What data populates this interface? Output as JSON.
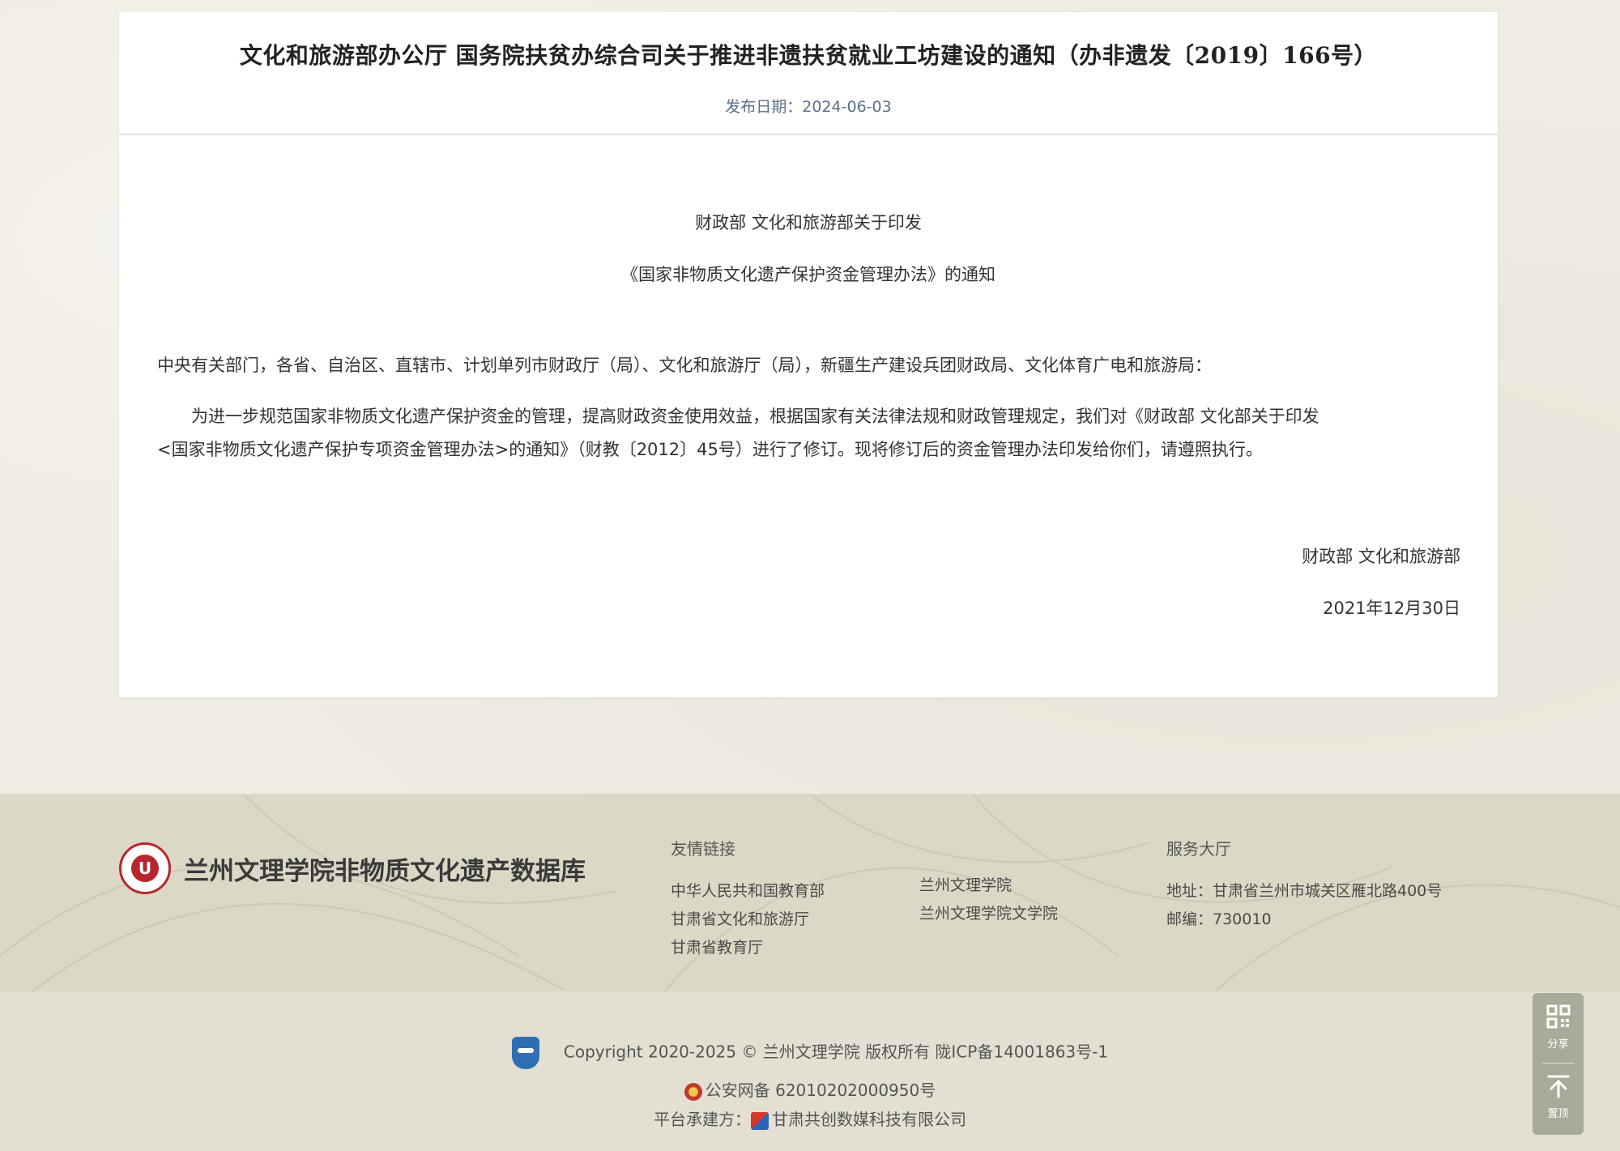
{
  "article": {
    "title": "文化和旅游部办公厅 国务院扶贫办综合司关于推进非遗扶贫就业工坊建设的通知（办非遗发〔2019〕166号）",
    "publish_label": "发布日期：",
    "publish_date": "2024-06-03",
    "doc_heading_1": "财政部 文化和旅游部关于印发",
    "doc_heading_2": "《国家非物质文化遗产保护资金管理办法》的通知",
    "addressee": "中央有关部门，各省、自治区、直辖市、计划单列市财政厅（局）、文化和旅游厅（局），新疆生产建设兵团财政局、文化体育广电和旅游局：",
    "body_line_1": "为进一步规范国家非物质文化遗产保护资金的管理，提高财政资金使用效益，根据国家有关法律法规和财政管理规定，我们对《财政部 文化部关于印发",
    "body_line_2": "<国家非物质文化遗产保护专项资金管理办法>的通知》（财教〔2012〕45号）进行了修订。现将修订后的资金管理办法印发给你们，请遵照执行。",
    "signature": "财政部  文化和旅游部",
    "sign_date": "2021年12月30日"
  },
  "footer": {
    "site_name": "兰州文理学院非物质文化遗产数据库",
    "links_title": "友情链接",
    "links_col1": [
      "中华人民共和国教育部",
      "甘肃省文化和旅游厅",
      "甘肃省教育厅"
    ],
    "links_col2": [
      "兰州文理学院",
      "兰州文理学院文学院"
    ],
    "service_title": "服务大厅",
    "address": "地址：甘肃省兰州市城关区雁北路400号",
    "postcode": "邮编：730010"
  },
  "bottom": {
    "copyright": "Copyright 2020-2025 © 兰州文理学院 版权所有 陇ICP备14001863号-1",
    "police_record": "公安网备 62010202000950号",
    "builder_label": "平台承建方：",
    "builder_name": "甘肃共创数媒科技有限公司"
  },
  "tools": {
    "share_label": "分享",
    "top_label": "置顶"
  },
  "icons": {
    "qr": "qr-code-icon",
    "top": "arrow-up-to-top-icon",
    "seal": "university-seal-logo",
    "badge": "trust-badge-icon",
    "police": "police-emblem-icon",
    "builder": "builder-logo-icon"
  },
  "colors": {
    "page_bg": "#efece3",
    "footer_bg": "#dcd8c6",
    "date_text": "#5b6e8a",
    "seal_red": "#b8262d"
  }
}
